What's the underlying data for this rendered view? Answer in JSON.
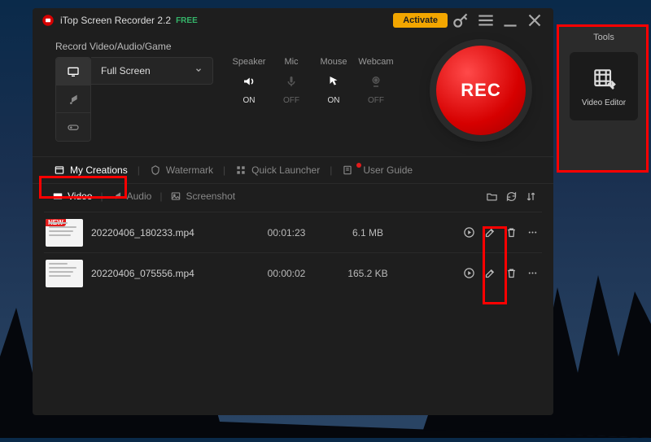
{
  "app": {
    "title": "iTop Screen Recorder 2.2",
    "free_label": "FREE",
    "activate_label": "Activate"
  },
  "record_section": {
    "header": "Record Video/Audio/Game",
    "screen_select": "Full Screen",
    "toggles": [
      {
        "label": "Speaker",
        "state": "ON",
        "on": true,
        "icon": "speaker-icon"
      },
      {
        "label": "Mic",
        "state": "OFF",
        "on": false,
        "icon": "mic-icon"
      },
      {
        "label": "Mouse",
        "state": "ON",
        "on": true,
        "icon": "mouse-icon"
      },
      {
        "label": "Webcam",
        "state": "OFF",
        "on": false,
        "icon": "webcam-icon"
      }
    ],
    "rec_label": "REC"
  },
  "tabs": {
    "items": [
      {
        "label": "My Creations",
        "active": true
      },
      {
        "label": "Watermark",
        "active": false
      },
      {
        "label": "Quick Launcher",
        "active": false
      },
      {
        "label": "User Guide",
        "active": false
      }
    ]
  },
  "subtabs": {
    "items": [
      {
        "label": "Video",
        "active": true
      },
      {
        "label": "Audio",
        "active": false
      },
      {
        "label": "Screenshot",
        "active": false
      }
    ]
  },
  "files": [
    {
      "name": "20220406_180233.mp4",
      "duration": "00:01:23",
      "size": "6.1 MB",
      "new": true
    },
    {
      "name": "20220406_075556.mp4",
      "duration": "00:00:02",
      "size": "165.2 KB",
      "new": false
    }
  ],
  "tools": {
    "title": "Tools",
    "items": [
      {
        "label": "Video Editor"
      }
    ]
  }
}
